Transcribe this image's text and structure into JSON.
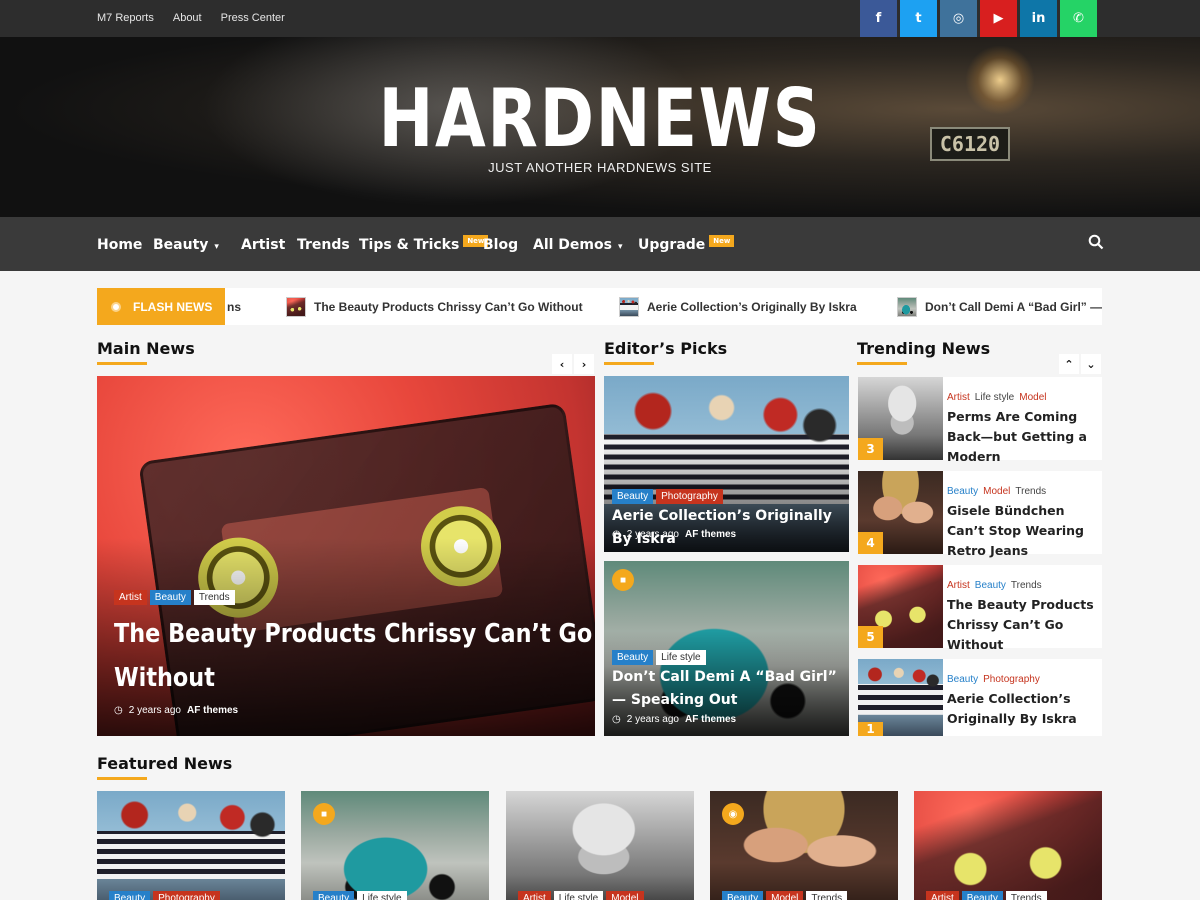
{
  "topbar": {
    "links": [
      "M7 Reports",
      "About",
      "Press Center"
    ],
    "social": [
      {
        "name": "facebook",
        "glyph": "f",
        "color": "#3b5998"
      },
      {
        "name": "twitter",
        "glyph": "t",
        "color": "#1da1f2"
      },
      {
        "name": "instagram",
        "glyph": "◎",
        "color": "#3f729b"
      },
      {
        "name": "youtube",
        "glyph": "▶",
        "color": "#d81f1f"
      },
      {
        "name": "linkedin",
        "glyph": "in",
        "color": "#0e76a8"
      },
      {
        "name": "whatsapp",
        "glyph": "✆",
        "color": "#25d366"
      }
    ]
  },
  "header": {
    "site_title": "HARDNEWS",
    "tagline": "JUST ANOTHER HARDNEWS SITE",
    "plate": "C6120"
  },
  "nav": {
    "items": [
      {
        "label": "Home"
      },
      {
        "label": "Beauty",
        "caret": "▾"
      },
      {
        "label": "Artist"
      },
      {
        "label": "Trends"
      },
      {
        "label": "Tips & Tricks",
        "badge": "New"
      },
      {
        "label": "Blog"
      },
      {
        "label": "All Demos",
        "caret": "▾"
      },
      {
        "label": "Upgrade",
        "badge": "New"
      }
    ],
    "search_icon": "⚲"
  },
  "flash": {
    "label": "FLASH NEWS",
    "lead_fragment": "ns",
    "items": [
      "The Beauty Products Chrissy Can’t Go Without",
      "Aerie Collection’s Originally By Iskra",
      "Don’t Call Demi A “Bad Girl” —"
    ]
  },
  "main_news": {
    "heading": "Main News",
    "prev": "‹",
    "next": "›",
    "tags": [
      "Artist",
      "Beauty",
      "Trends"
    ],
    "title": "The Beauty Products Chrissy Can’t Go Without",
    "time": "2 years ago",
    "author": "AF themes"
  },
  "editors_picks": {
    "heading": "Editor’s Picks",
    "posts": [
      {
        "tags": [
          "Beauty",
          "Photography"
        ],
        "title": "Aerie Collection’s Originally By Iskra",
        "time": "2 years ago",
        "author": "AF themes"
      },
      {
        "tags": [
          "Beauty",
          "Life style"
        ],
        "title": "Don’t Call Demi A “Bad Girl” — Speaking Out",
        "time": "2 years ago",
        "author": "AF themes"
      }
    ]
  },
  "trending": {
    "heading": "Trending News",
    "up": "⌃",
    "down": "⌄",
    "posts": [
      {
        "num": "3",
        "cats": [
          "Artist",
          "Life style",
          "Model"
        ],
        "title": "Perms Are Coming Back—but Getting a Modern"
      },
      {
        "num": "4",
        "cats": [
          "Beauty",
          "Model",
          "Trends"
        ],
        "title": "Gisele Bündchen Can’t Stop Wearing Retro Jeans"
      },
      {
        "num": "5",
        "cats": [
          "Artist",
          "Beauty",
          "Trends"
        ],
        "title": "The Beauty Products Chrissy Can’t Go Without"
      },
      {
        "num": "1",
        "cats": [
          "Beauty",
          "Photography"
        ],
        "title": "Aerie Collection’s Originally By Iskra"
      }
    ]
  },
  "featured": {
    "heading": "Featured News",
    "posts": [
      {
        "tags": [
          "Beauty",
          "Photography"
        ]
      },
      {
        "tags": [
          "Beauty",
          "Life style"
        ]
      },
      {
        "tags": [
          "Artist",
          "Life style",
          "Model"
        ]
      },
      {
        "tags": [
          "Beauty",
          "Model",
          "Trends"
        ]
      },
      {
        "tags": [
          "Artist",
          "Beauty",
          "Trends"
        ]
      }
    ]
  },
  "colors": {
    "accent": "#f4a81d",
    "tag_red": "#c6341e",
    "tag_blue": "#2680c9",
    "nav_bg": "#3a3a3a",
    "topbar_bg": "#2d2d2d"
  },
  "icons": {
    "clock": "◷",
    "video": "■",
    "camera": "◉"
  }
}
